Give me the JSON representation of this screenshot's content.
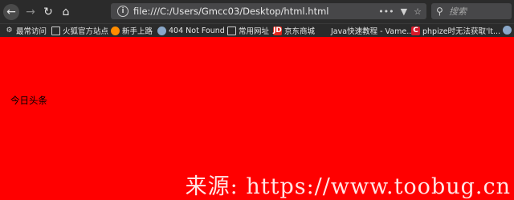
{
  "browser": {
    "url": "file:///C:/Users/Gmcc03/Desktop/html.html",
    "search_placeholder": "搜索"
  },
  "bookmarks": [
    {
      "label": "最常访问",
      "icon": "gear-icon"
    },
    {
      "label": "火狐官方站点",
      "icon": "folder-icon"
    },
    {
      "label": "新手上路",
      "icon": "firefox-icon"
    },
    {
      "label": "404 Not Found",
      "icon": "globe-icon"
    },
    {
      "label": "常用网址",
      "icon": "folder-icon"
    },
    {
      "label": "京东商城",
      "icon": "jd-icon"
    },
    {
      "label": "Java快速教程 - Vame...",
      "icon": "none"
    },
    {
      "label": "phpize时无法获取'lt...",
      "icon": "c-icon"
    }
  ],
  "page": {
    "text": "今日头条"
  },
  "watermark": {
    "text": "来源: https://www.toobug.cn"
  },
  "colors": {
    "page_background": "#ff0000",
    "toolbar_background": "#2b2b2b",
    "urlbar_background": "#474749"
  }
}
